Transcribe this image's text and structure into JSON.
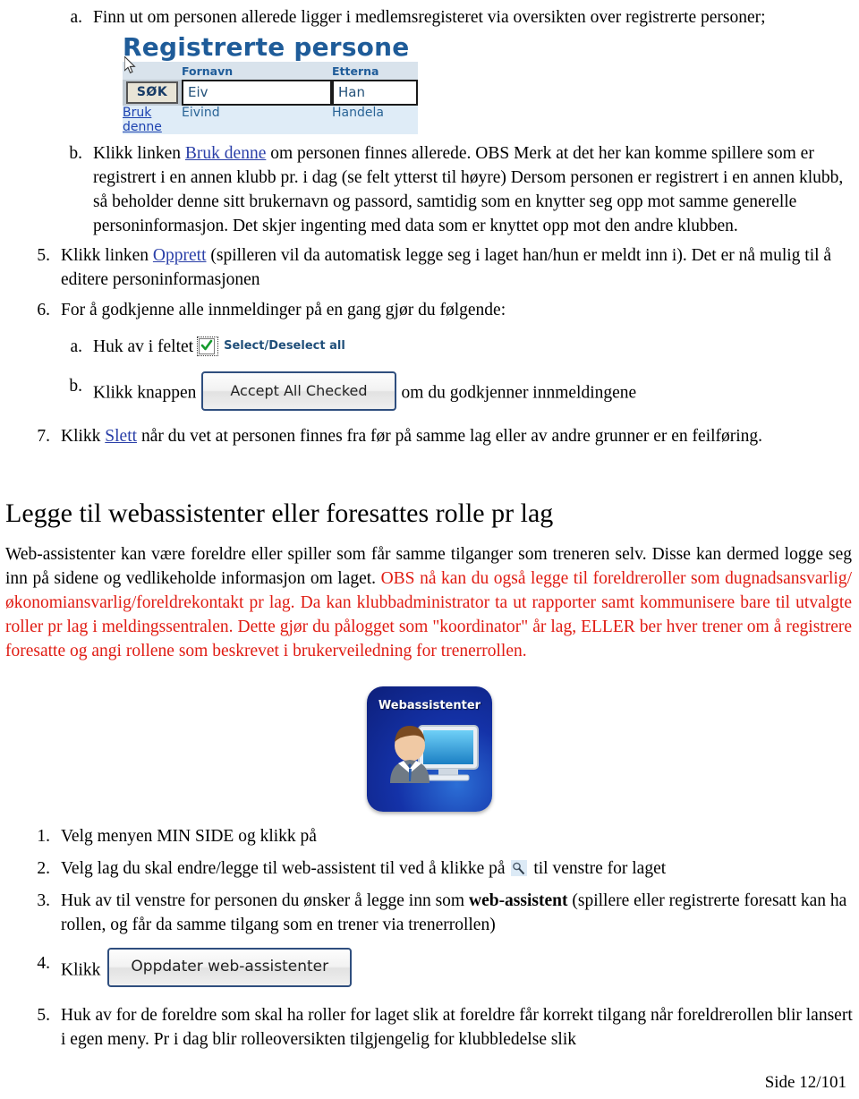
{
  "document": {
    "footer_page": "Side 12/101"
  },
  "steps_alpha_top": {
    "a": {
      "marker": "a.",
      "text": "Finn ut om personen allerede ligger i medlemsregisteret via oversikten over registrerte personer;"
    },
    "b": {
      "marker": "b.",
      "text_before_link": "Klikk linken ",
      "link": "Bruk denne",
      "text_after_link": " om personen finnes allerede. OBS Merk at det her kan komme spillere som er registrert i en annen klubb pr. i dag (se felt ytterst til høyre) Dersom personen er registrert i en annen klubb, så beholder denne sitt brukernavn og passord, samtidig som en knytter seg opp mot samme generelle personinformasjon. Det skjer ingenting med data som er knyttet opp mot den andre klubben."
    }
  },
  "registrerte_screenshot": {
    "title": "Registrerte persone",
    "cursor_icon": "mouse-pointer-icon",
    "columns": [
      "",
      "Fornavn",
      "Etterna"
    ],
    "search_button": "SØK",
    "inputs": {
      "fornavn_value": "Eiv",
      "etternavn_value": "Han"
    },
    "result_row": {
      "action_link_line1": "Bruk",
      "action_link_line2": "denne",
      "fornavn": "Eivind",
      "etternavn": "Handela"
    }
  },
  "steps_numbered_top": {
    "five": {
      "marker": "5.",
      "text_before_link": "Klikk linken ",
      "link": "Opprett",
      "text_after_link": " (spilleren vil da automatisk legge seg i laget han/hun er meldt inn i). Det er nå mulig til å editere personinformasjonen"
    },
    "six": {
      "marker": "6.",
      "text": "For å godkjenne alle innmeldinger på en gang gjør du følgende:",
      "sub_a": {
        "marker": "a.",
        "text": "Huk av i feltet",
        "checkbox_icon": "checked-checkbox-icon",
        "checkbox_label": "Select/Deselect all"
      },
      "sub_b": {
        "marker": "b.",
        "text_before_button": "Klikk knappen",
        "button_label": "Accept All Checked",
        "text_after_button": "om du godkjenner innmeldingene"
      }
    },
    "seven": {
      "marker": "7.",
      "text_before_link": "Klikk ",
      "link": "Slett",
      "text_after_link": " når du vet at personen finnes fra før på samme lag eller av andre grunner er en feilføring."
    }
  },
  "section": {
    "heading": "Legge til webassistenter eller foresattes rolle pr lag",
    "paragraph_black": "Web-assistenter kan være foreldre eller spiller som får samme tilganger som treneren selv. Disse kan dermed logge seg inn på sidene og vedlikeholde informasjon om laget. ",
    "paragraph_red": "OBS nå kan du også legge til foreldreroller som dugnadsansvarlig/økonomiansvarlig/foreldrekontakt pr lag. Da kan klubbadministrator ta ut rapporter samt kommunisere bare til utvalgte roller pr lag i meldingssentralen. Dette gjør du pålogget som \"koordinator\" år lag, ELLER ber hver trener om å registrere foresatte og angi rollene som beskrevet i brukerveiledning for trenerrollen."
  },
  "webassistent_icon": {
    "label": "Webassistenter",
    "icon_name": "webassistent-person-monitor-icon"
  },
  "steps_numbered_bottom": [
    {
      "marker": "1.",
      "text": "Velg menyen MIN SIDE og klikk på"
    },
    {
      "marker": "2.",
      "text_before_icon": "Velg lag du skal endre/legge til web-assistent til ved å klikke på ",
      "icon_name": "edit-magnifier-icon",
      "text_after_icon": " til venstre for laget"
    },
    {
      "marker": "3.",
      "text_before_bold": "Huk av til venstre for personen du ønsker å legge inn som ",
      "bold": "web-assistent",
      "text_after_bold": " (spillere eller registrerte foresatt kan ha rollen, og får da samme tilgang som en trener via trenerrollen)"
    },
    {
      "marker": "4.",
      "text_before_button": "Klikk",
      "button_label": "Oppdater web-assistenter"
    },
    {
      "marker": "5.",
      "text": "Huk av for de foreldre som skal ha roller for laget slik at foreldre får korrekt tilgang når foreldrerollen blir lansert i egen meny. Pr i dag blir rolleoversikten tilgjengelig for klubbledelse slik"
    }
  ],
  "colors": {
    "link": "#2A3FA8",
    "red_text": "#E01B12",
    "app_heading_blue": "#1F5C99",
    "button_border": "#2F4E7E"
  }
}
